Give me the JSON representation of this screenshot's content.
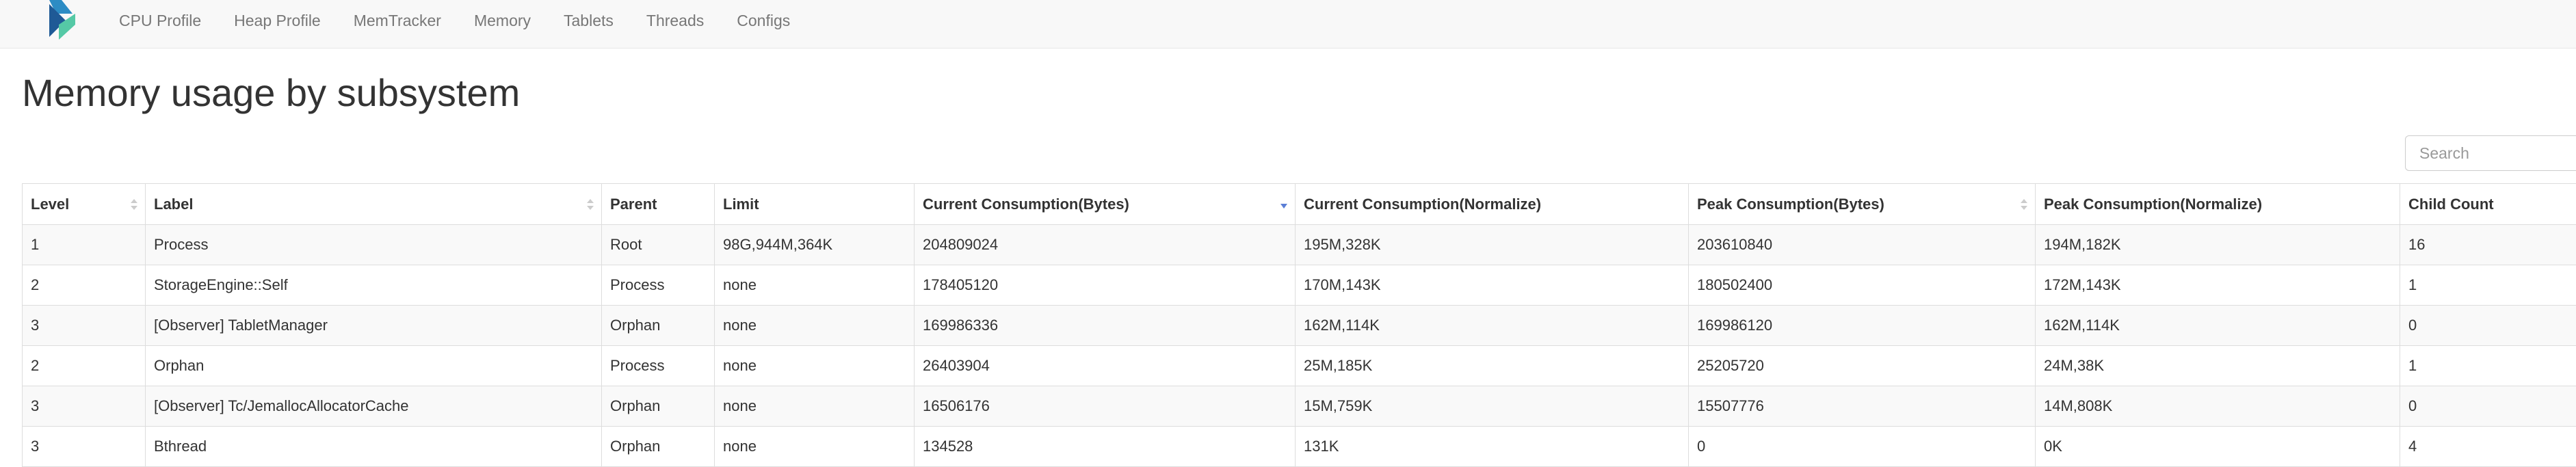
{
  "nav": {
    "links": [
      "CPU Profile",
      "Heap Profile",
      "MemTracker",
      "Memory",
      "Tablets",
      "Threads",
      "Configs"
    ]
  },
  "page": {
    "title": "Memory usage by subsystem"
  },
  "search": {
    "placeholder": "Search"
  },
  "table": {
    "columns": [
      "Level",
      "Label",
      "Parent",
      "Limit",
      "Current Consumption(Bytes)",
      "Current Consumption(Normalize)",
      "Peak Consumption(Bytes)",
      "Peak Consumption(Normalize)",
      "Child Count"
    ],
    "sorted_column": "Current Consumption(Bytes)",
    "sort_direction": "descending",
    "rows": [
      [
        "1",
        "Process",
        "Root",
        "98G,944M,364K",
        "204809024",
        "195M,328K",
        "203610840",
        "194M,182K",
        "16"
      ],
      [
        "2",
        "StorageEngine::Self",
        "Process",
        "none",
        "178405120",
        "170M,143K",
        "180502400",
        "172M,143K",
        "1"
      ],
      [
        "3",
        "[Observer] TabletManager",
        "Orphan",
        "none",
        "169986336",
        "162M,114K",
        "169986120",
        "162M,114K",
        "0"
      ],
      [
        "2",
        "Orphan",
        "Process",
        "none",
        "26403904",
        "25M,185K",
        "25205720",
        "24M,38K",
        "1"
      ],
      [
        "3",
        "[Observer] Tc/JemallocAllocatorCache",
        "Orphan",
        "none",
        "16506176",
        "15M,759K",
        "15507776",
        "14M,808K",
        "0"
      ],
      [
        "3",
        "Bthread",
        "Orphan",
        "none",
        "134528",
        "131K",
        "0",
        "0K",
        "4"
      ]
    ]
  }
}
